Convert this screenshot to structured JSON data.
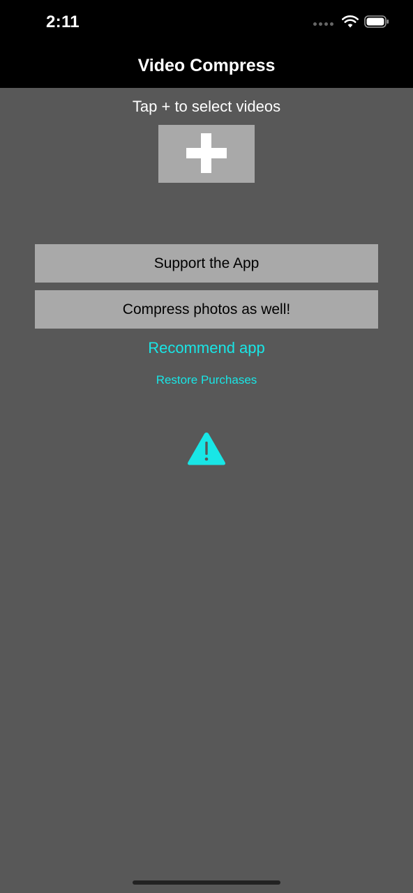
{
  "status_bar": {
    "time": "2:11",
    "icons": [
      "signal-dots-icon",
      "wifi-icon",
      "battery-icon"
    ]
  },
  "nav": {
    "title": "Video Compress"
  },
  "main": {
    "instruction": "Tap + to select videos",
    "add_button_icon": "plus-icon",
    "support_label": "Support the App",
    "photos_label": "Compress photos as well!",
    "recommend_label": "Recommend app",
    "restore_label": "Restore Purchases",
    "warning_icon": "warning-triangle-icon"
  },
  "colors": {
    "background": "#585858",
    "bars": "#000000",
    "button": "#a9a9a9",
    "accent": "#19e6e6"
  }
}
